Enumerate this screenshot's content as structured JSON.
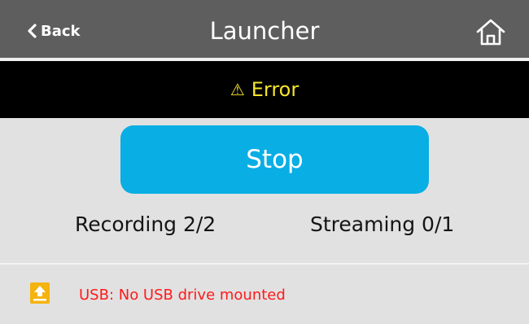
{
  "header": {
    "back_label": "Back",
    "title": "Launcher",
    "back_icon": "chevron-left-icon",
    "home_icon": "home-icon"
  },
  "error_bar": {
    "icon": "warning-icon",
    "icon_glyph": "⚠",
    "label": "Error",
    "color": "#f5e52a"
  },
  "stop_button": {
    "label": "Stop",
    "color": "#09aee4"
  },
  "status": {
    "recording": "Recording 2/2",
    "streaming": "Streaming 0/1"
  },
  "usb": {
    "icon": "upload-icon",
    "message": "USB: No USB drive mounted",
    "color": "#ff1a1a"
  }
}
